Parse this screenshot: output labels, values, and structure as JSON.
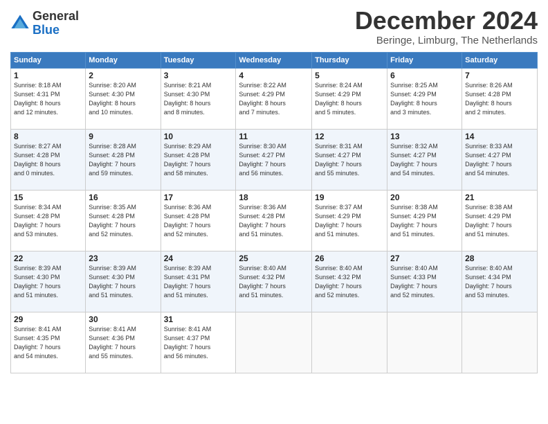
{
  "header": {
    "logo_line1": "General",
    "logo_line2": "Blue",
    "month_title": "December 2024",
    "location": "Beringe, Limburg, The Netherlands"
  },
  "weekdays": [
    "Sunday",
    "Monday",
    "Tuesday",
    "Wednesday",
    "Thursday",
    "Friday",
    "Saturday"
  ],
  "weeks": [
    [
      {
        "day": "1",
        "lines": [
          "Sunrise: 8:18 AM",
          "Sunset: 4:31 PM",
          "Daylight: 8 hours",
          "and 12 minutes."
        ]
      },
      {
        "day": "2",
        "lines": [
          "Sunrise: 8:20 AM",
          "Sunset: 4:30 PM",
          "Daylight: 8 hours",
          "and 10 minutes."
        ]
      },
      {
        "day": "3",
        "lines": [
          "Sunrise: 8:21 AM",
          "Sunset: 4:30 PM",
          "Daylight: 8 hours",
          "and 8 minutes."
        ]
      },
      {
        "day": "4",
        "lines": [
          "Sunrise: 8:22 AM",
          "Sunset: 4:29 PM",
          "Daylight: 8 hours",
          "and 7 minutes."
        ]
      },
      {
        "day": "5",
        "lines": [
          "Sunrise: 8:24 AM",
          "Sunset: 4:29 PM",
          "Daylight: 8 hours",
          "and 5 minutes."
        ]
      },
      {
        "day": "6",
        "lines": [
          "Sunrise: 8:25 AM",
          "Sunset: 4:29 PM",
          "Daylight: 8 hours",
          "and 3 minutes."
        ]
      },
      {
        "day": "7",
        "lines": [
          "Sunrise: 8:26 AM",
          "Sunset: 4:28 PM",
          "Daylight: 8 hours",
          "and 2 minutes."
        ]
      }
    ],
    [
      {
        "day": "8",
        "lines": [
          "Sunrise: 8:27 AM",
          "Sunset: 4:28 PM",
          "Daylight: 8 hours",
          "and 0 minutes."
        ]
      },
      {
        "day": "9",
        "lines": [
          "Sunrise: 8:28 AM",
          "Sunset: 4:28 PM",
          "Daylight: 7 hours",
          "and 59 minutes."
        ]
      },
      {
        "day": "10",
        "lines": [
          "Sunrise: 8:29 AM",
          "Sunset: 4:28 PM",
          "Daylight: 7 hours",
          "and 58 minutes."
        ]
      },
      {
        "day": "11",
        "lines": [
          "Sunrise: 8:30 AM",
          "Sunset: 4:27 PM",
          "Daylight: 7 hours",
          "and 56 minutes."
        ]
      },
      {
        "day": "12",
        "lines": [
          "Sunrise: 8:31 AM",
          "Sunset: 4:27 PM",
          "Daylight: 7 hours",
          "and 55 minutes."
        ]
      },
      {
        "day": "13",
        "lines": [
          "Sunrise: 8:32 AM",
          "Sunset: 4:27 PM",
          "Daylight: 7 hours",
          "and 54 minutes."
        ]
      },
      {
        "day": "14",
        "lines": [
          "Sunrise: 8:33 AM",
          "Sunset: 4:27 PM",
          "Daylight: 7 hours",
          "and 54 minutes."
        ]
      }
    ],
    [
      {
        "day": "15",
        "lines": [
          "Sunrise: 8:34 AM",
          "Sunset: 4:28 PM",
          "Daylight: 7 hours",
          "and 53 minutes."
        ]
      },
      {
        "day": "16",
        "lines": [
          "Sunrise: 8:35 AM",
          "Sunset: 4:28 PM",
          "Daylight: 7 hours",
          "and 52 minutes."
        ]
      },
      {
        "day": "17",
        "lines": [
          "Sunrise: 8:36 AM",
          "Sunset: 4:28 PM",
          "Daylight: 7 hours",
          "and 52 minutes."
        ]
      },
      {
        "day": "18",
        "lines": [
          "Sunrise: 8:36 AM",
          "Sunset: 4:28 PM",
          "Daylight: 7 hours",
          "and 51 minutes."
        ]
      },
      {
        "day": "19",
        "lines": [
          "Sunrise: 8:37 AM",
          "Sunset: 4:29 PM",
          "Daylight: 7 hours",
          "and 51 minutes."
        ]
      },
      {
        "day": "20",
        "lines": [
          "Sunrise: 8:38 AM",
          "Sunset: 4:29 PM",
          "Daylight: 7 hours",
          "and 51 minutes."
        ]
      },
      {
        "day": "21",
        "lines": [
          "Sunrise: 8:38 AM",
          "Sunset: 4:29 PM",
          "Daylight: 7 hours",
          "and 51 minutes."
        ]
      }
    ],
    [
      {
        "day": "22",
        "lines": [
          "Sunrise: 8:39 AM",
          "Sunset: 4:30 PM",
          "Daylight: 7 hours",
          "and 51 minutes."
        ]
      },
      {
        "day": "23",
        "lines": [
          "Sunrise: 8:39 AM",
          "Sunset: 4:30 PM",
          "Daylight: 7 hours",
          "and 51 minutes."
        ]
      },
      {
        "day": "24",
        "lines": [
          "Sunrise: 8:39 AM",
          "Sunset: 4:31 PM",
          "Daylight: 7 hours",
          "and 51 minutes."
        ]
      },
      {
        "day": "25",
        "lines": [
          "Sunrise: 8:40 AM",
          "Sunset: 4:32 PM",
          "Daylight: 7 hours",
          "and 51 minutes."
        ]
      },
      {
        "day": "26",
        "lines": [
          "Sunrise: 8:40 AM",
          "Sunset: 4:32 PM",
          "Daylight: 7 hours",
          "and 52 minutes."
        ]
      },
      {
        "day": "27",
        "lines": [
          "Sunrise: 8:40 AM",
          "Sunset: 4:33 PM",
          "Daylight: 7 hours",
          "and 52 minutes."
        ]
      },
      {
        "day": "28",
        "lines": [
          "Sunrise: 8:40 AM",
          "Sunset: 4:34 PM",
          "Daylight: 7 hours",
          "and 53 minutes."
        ]
      }
    ],
    [
      {
        "day": "29",
        "lines": [
          "Sunrise: 8:41 AM",
          "Sunset: 4:35 PM",
          "Daylight: 7 hours",
          "and 54 minutes."
        ]
      },
      {
        "day": "30",
        "lines": [
          "Sunrise: 8:41 AM",
          "Sunset: 4:36 PM",
          "Daylight: 7 hours",
          "and 55 minutes."
        ]
      },
      {
        "day": "31",
        "lines": [
          "Sunrise: 8:41 AM",
          "Sunset: 4:37 PM",
          "Daylight: 7 hours",
          "and 56 minutes."
        ]
      },
      null,
      null,
      null,
      null
    ]
  ]
}
